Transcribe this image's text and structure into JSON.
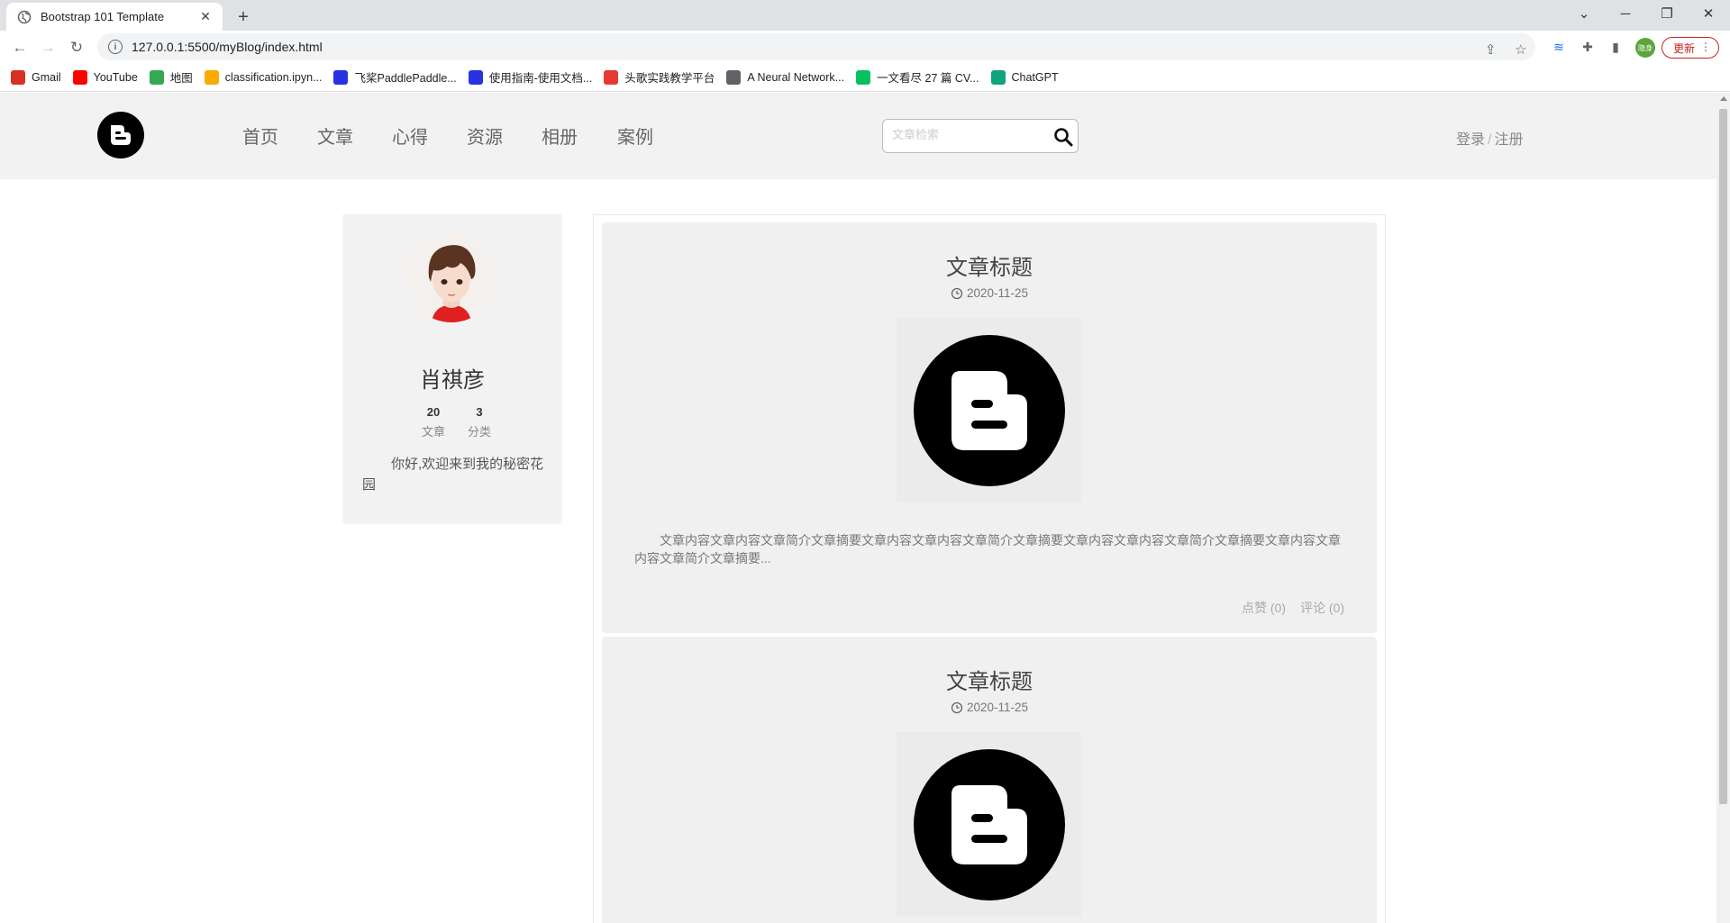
{
  "browser": {
    "tab_title": "Bootstrap 101 Template",
    "url": "127.0.0.1:5500/myBlog/index.html",
    "profile_label": "隐身",
    "update_label": "更新",
    "bookmarks": [
      {
        "label": "Gmail",
        "icon": "gmail-icon",
        "color": "#d93025"
      },
      {
        "label": "YouTube",
        "icon": "youtube-icon",
        "color": "#ff0000"
      },
      {
        "label": "地图",
        "icon": "maps-icon",
        "color": "#34a853"
      },
      {
        "label": "classification.ipyn...",
        "icon": "colab-icon",
        "color": "#f9ab00"
      },
      {
        "label": "飞桨PaddlePaddle...",
        "icon": "paddle-icon",
        "color": "#2932e1"
      },
      {
        "label": "使用指南-使用文档...",
        "icon": "paddle-icon",
        "color": "#2932e1"
      },
      {
        "label": "头歌实践教学平台",
        "icon": "educoder-icon",
        "color": "#e53935"
      },
      {
        "label": "A Neural Network...",
        "icon": "page-icon",
        "color": "#5f6368"
      },
      {
        "label": "一文看尽 27 篇 CV...",
        "icon": "wechat-icon",
        "color": "#07c160"
      },
      {
        "label": "ChatGPT",
        "icon": "chatgpt-icon",
        "color": "#10a37f"
      }
    ]
  },
  "site": {
    "nav": [
      "首页",
      "文章",
      "心得",
      "资源",
      "相册",
      "案例"
    ],
    "search_placeholder": "文章检索",
    "login": "登录",
    "separator": "/",
    "register": "注册"
  },
  "profile": {
    "name": "肖祺彦",
    "articles_count": "20",
    "articles_label": "文章",
    "categories_count": "3",
    "categories_label": "分类",
    "bio": "你好,欢迎来到我的秘密花园"
  },
  "articles": [
    {
      "title": "文章标题",
      "date": "2020-11-25",
      "summary": "文章内容文章内容文章简介文章摘要文章内容文章内容文章简介文章摘要文章内容文章内容文章简介文章摘要文章内容文章内容文章简介文章摘要...",
      "likes": "点赞 (0)",
      "comments": "评论 (0)"
    },
    {
      "title": "文章标题",
      "date": "2020-11-25"
    }
  ]
}
